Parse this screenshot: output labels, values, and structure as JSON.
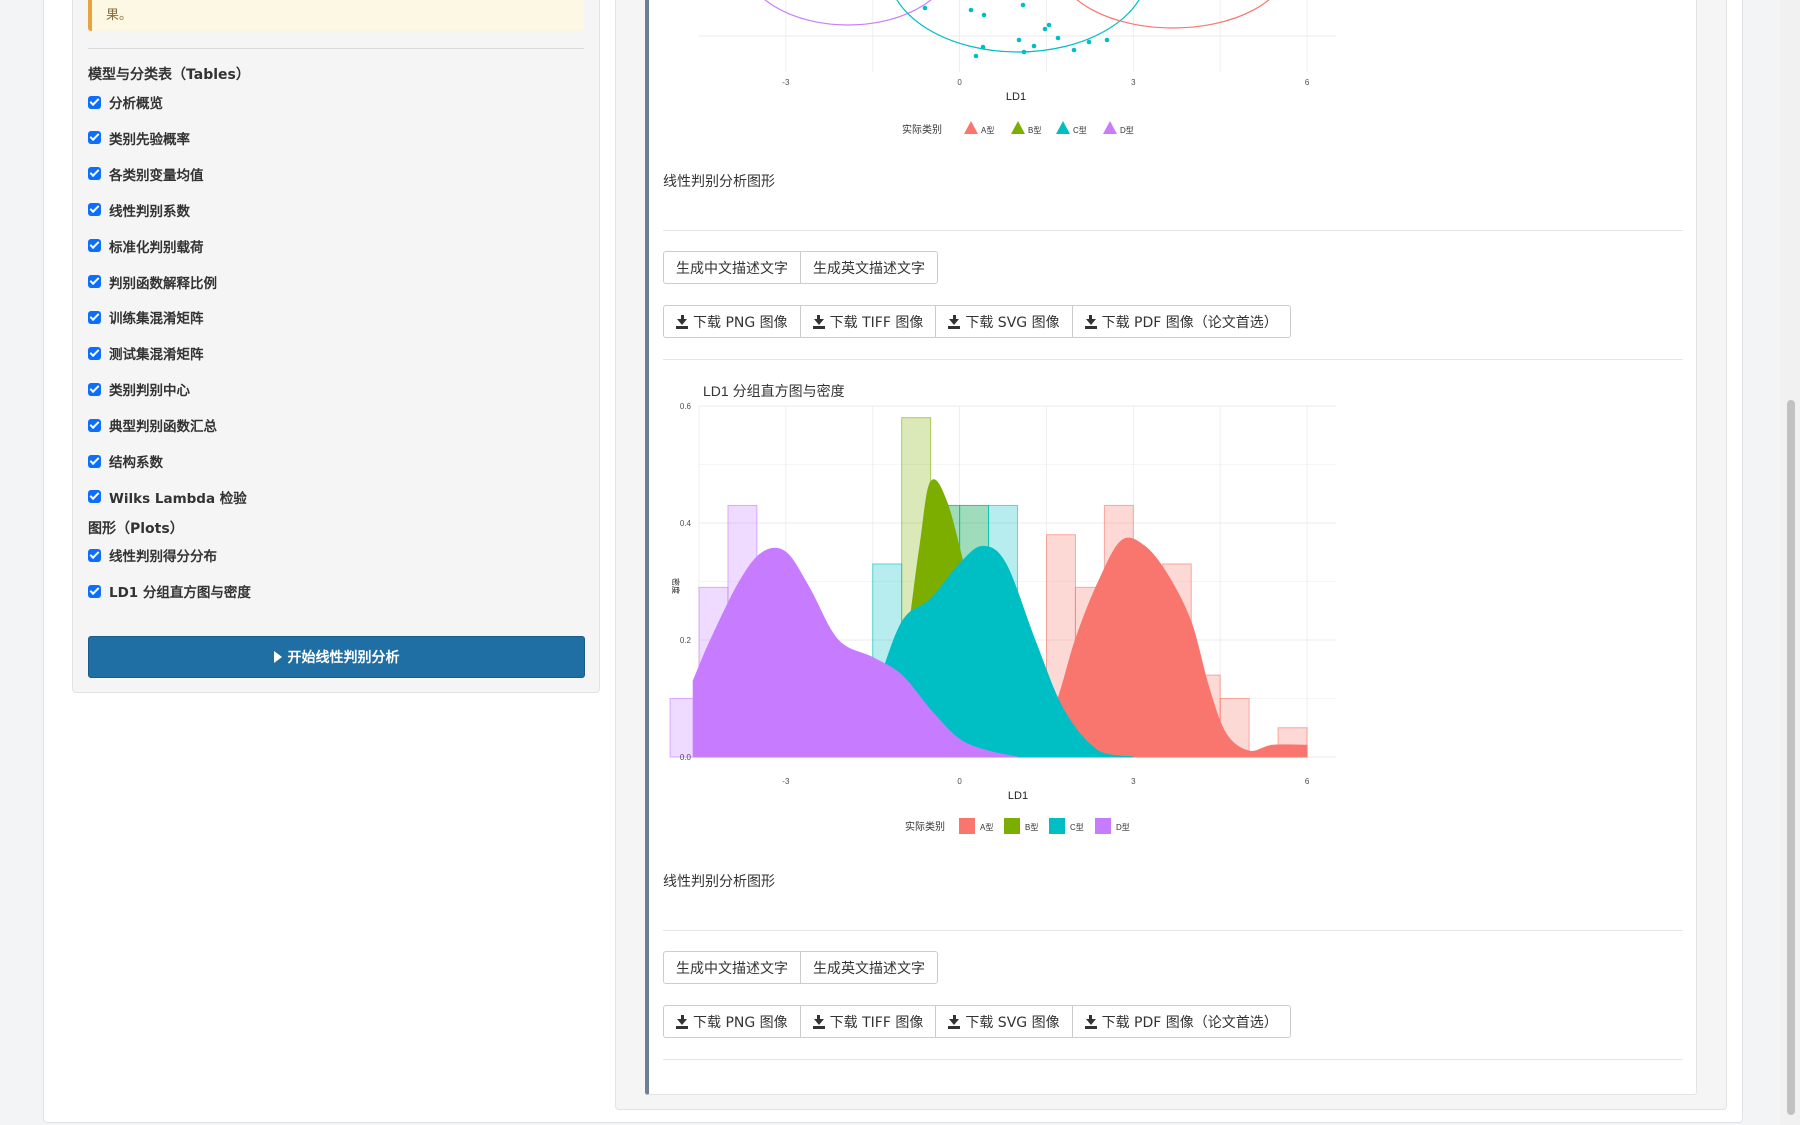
{
  "alert": {
    "text": "果。"
  },
  "tables_section": {
    "title": "模型与分类表（Tables）",
    "items": [
      "分析概览",
      "类别先验概率",
      "各类别变量均值",
      "线性判别系数",
      "标准化判别载荷",
      "判别函数解释比例",
      "训练集混淆矩阵",
      "测试集混淆矩阵",
      "类别判别中心",
      "典型判别函数汇总",
      "结构系数",
      "Wilks Lambda 检验"
    ]
  },
  "plots_section": {
    "title": "图形（Plots）",
    "items": [
      "线性判别得分分布",
      "LD1 分组直方图与密度"
    ]
  },
  "run_button": {
    "label": "开始线性判别分析"
  },
  "top_chart": {
    "xlabel": "LD1",
    "x_ticks": [
      "-3",
      "0",
      "3",
      "6"
    ],
    "legend_title": "实际类别",
    "legend": [
      "A型",
      "B型",
      "C型",
      "D型"
    ]
  },
  "plot_caption_1": "线性判别分析图形",
  "text_buttons_1": [
    "生成中文描述文字",
    "生成英文描述文字"
  ],
  "download_buttons_1": [
    "下载 PNG 图像",
    "下载 TIFF 图像",
    "下载 SVG 图像",
    "下载 PDF 图像（论文首选）"
  ],
  "hist_chart": {
    "title": "LD1 分组直方图与密度",
    "xlabel": "LD1",
    "ylabel": "密度",
    "x_ticks": [
      "-3",
      "0",
      "3",
      "6"
    ],
    "y_ticks": [
      "0.0",
      "0.2",
      "0.4",
      "0.6"
    ],
    "legend_title": "实际类别",
    "legend": [
      "A型",
      "B型",
      "C型",
      "D型"
    ]
  },
  "plot_caption_2": "线性判别分析图形",
  "text_buttons_2": [
    "生成中文描述文字",
    "生成英文描述文字"
  ],
  "download_buttons_2": [
    "下载 PNG 图像",
    "下载 TIFF 图像",
    "下载 SVG 图像",
    "下载 PDF 图像（论文首选）"
  ],
  "colors": {
    "A": "#F8766D",
    "B": "#7CAE00",
    "C": "#00BFC4",
    "D": "#C77CFF",
    "primary": "#206fa4"
  },
  "chart_data": {
    "type": "bar",
    "title": "LD1 分组直方图与密度",
    "xlabel": "LD1",
    "ylabel": "密度",
    "xlim": [
      -4.5,
      6.5
    ],
    "ylim": [
      0,
      0.6
    ],
    "grid": true,
    "legend_position": "bottom",
    "legend_title": "实际类别",
    "series": [
      {
        "name": "A型",
        "histogram": {
          "bin_centers": [
            1.75,
            2.25,
            2.75,
            3.25,
            3.75,
            4.25,
            4.75,
            5.25,
            5.75
          ],
          "values": [
            0.38,
            0.29,
            0.43,
            0.29,
            0.33,
            0.14,
            0.1,
            0.0,
            0.05
          ]
        },
        "density": {
          "x": [
            1.3,
            1.7,
            2.0,
            2.4,
            2.8,
            3.2,
            3.6,
            4.0,
            4.3,
            4.6,
            5.0,
            5.4,
            6.0
          ],
          "y": [
            0.0,
            0.1,
            0.2,
            0.3,
            0.37,
            0.36,
            0.31,
            0.23,
            0.12,
            0.04,
            0.01,
            0.02,
            0.02
          ]
        }
      },
      {
        "name": "B型",
        "histogram": {
          "bin_centers": [
            -0.75,
            -0.25,
            0.25
          ],
          "values": [
            0.58,
            0.43,
            0.43
          ]
        },
        "density": {
          "x": [
            -1.5,
            -1.0,
            -0.7,
            -0.5,
            -0.2,
            0.2,
            0.7,
            1.2,
            2.0,
            3.0
          ],
          "y": [
            0.0,
            0.15,
            0.35,
            0.47,
            0.43,
            0.28,
            0.14,
            0.05,
            0.01,
            0.0
          ]
        }
      },
      {
        "name": "C型",
        "histogram": {
          "bin_centers": [
            -1.25,
            -0.25,
            0.25,
            0.75
          ],
          "values": [
            0.33,
            0.43,
            0.43,
            0.43
          ]
        },
        "density": {
          "x": [
            -2.0,
            -1.5,
            -1.0,
            -0.5,
            0.0,
            0.4,
            0.8,
            1.3,
            1.8,
            2.4,
            3.0
          ],
          "y": [
            0.0,
            0.1,
            0.23,
            0.27,
            0.33,
            0.36,
            0.33,
            0.2,
            0.08,
            0.01,
            0.0
          ]
        }
      },
      {
        "name": "D型",
        "histogram": {
          "bin_centers": [
            -4.75,
            -4.25,
            -3.75,
            -3.25,
            -2.75,
            -2.25
          ],
          "values": [
            0.1,
            0.29,
            0.43,
            0.33,
            0.14,
            0.05
          ]
        },
        "density": {
          "x": [
            -4.6,
            -4.3,
            -3.8,
            -3.4,
            -3.0,
            -2.6,
            -2.1,
            -1.5,
            -1.0,
            -0.5,
            0.0,
            0.5,
            1.0
          ],
          "y": [
            0.13,
            0.2,
            0.3,
            0.35,
            0.35,
            0.29,
            0.2,
            0.17,
            0.14,
            0.08,
            0.03,
            0.01,
            0.0
          ]
        }
      }
    ]
  }
}
